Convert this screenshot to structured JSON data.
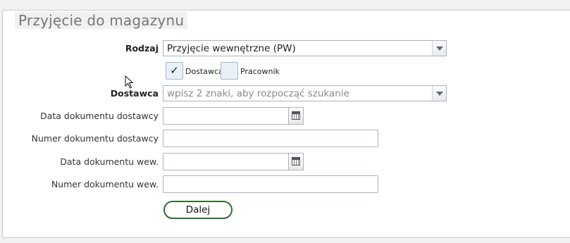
{
  "section": {
    "title": "Przyjęcie do magazynu"
  },
  "form": {
    "rodzaj": {
      "label": "Rodzaj",
      "value": "Przyjęcie wewnętrzne (PW)"
    },
    "source_type": {
      "dostawca": {
        "label": "Dostawca",
        "checked": true,
        "mark": "✓"
      },
      "pracownik": {
        "label": "Pracownik",
        "checked": false
      }
    },
    "dostawca": {
      "label": "Dostawca",
      "placeholder": "wpisz 2 znaki, aby rozpocząć szukanie"
    },
    "data_dok_dostawcy": {
      "label": "Data dokumentu dostawcy",
      "value": ""
    },
    "numer_dok_dostawcy": {
      "label": "Numer dokumentu dostawcy",
      "value": ""
    },
    "data_dok_wew": {
      "label": "Data dokumentu wew.",
      "value": ""
    },
    "numer_dok_wew": {
      "label": "Numer dokumentu wew.",
      "value": ""
    },
    "submit_label": "Dalej"
  },
  "icons": {
    "dropdown": "chevron-down-icon",
    "date": "calendar-icon",
    "cursor": "mouse-pointer-icon"
  },
  "colors": {
    "button_border": "#2f6e2f",
    "checkbox_bg": "#e9f0f8"
  }
}
